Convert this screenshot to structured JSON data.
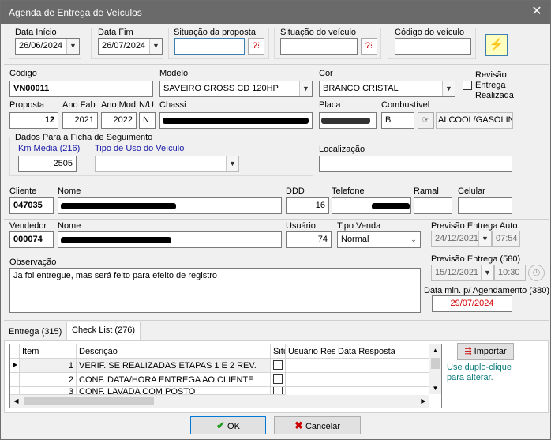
{
  "window": {
    "title": "Agenda de Entrega de Veículos",
    "close": "✕"
  },
  "filters": {
    "data_inicio_label": "Data Início",
    "data_inicio_value": "26/06/2024",
    "data_fim_label": "Data Fim",
    "data_fim_value": "26/07/2024",
    "situacao_proposta_label": "Situação da proposta",
    "situacao_veiculo_label": "Situação do veículo",
    "codigo_veiculo_label": "Código do veículo"
  },
  "vehicle": {
    "codigo_label": "Código",
    "codigo_value": "VN00011",
    "modelo_label": "Modelo",
    "modelo_value": "SAVEIRO CROSS CD 120HP",
    "cor_label": "Cor",
    "cor_value": "BRANCO CRISTAL",
    "revisao_label_1": "Revisão",
    "revisao_label_2": "Entrega",
    "revisao_label_3": "Realizada",
    "proposta_label": "Proposta",
    "proposta_value": "12",
    "ano_fab_label": "Ano Fab",
    "ano_fab_value": "2021",
    "ano_mod_label": "Ano Mod",
    "ano_mod_value": "2022",
    "nu_label": "N/U",
    "nu_value": "N",
    "chassi_label": "Chassi",
    "placa_label": "Placa",
    "combustivel_label": "Combustível",
    "combustivel_code": "B",
    "combustivel_desc": "ALCOOL/GASOLINA",
    "ficha_label": "Dados Para a Ficha de Seguimento",
    "km_label": "Km Média (216)",
    "km_value": "2505",
    "tipo_uso_label": "Tipo de Uso do Veículo",
    "localizacao_label": "Localização"
  },
  "cliente": {
    "cliente_label": "Cliente",
    "cliente_value": "047035",
    "nome_label": "Nome",
    "ddd_label": "DDD",
    "ddd_value": "16",
    "telefone_label": "Telefone",
    "ramal_label": "Ramal",
    "celular_label": "Celular"
  },
  "vendedor": {
    "vendedor_label": "Vendedor",
    "vendedor_value": "000074",
    "nome_label": "Nome",
    "usuario_label": "Usuário",
    "usuario_value": "74",
    "tipo_venda_label": "Tipo Venda",
    "tipo_venda_value": "Normal",
    "prev_auto_label": "Previsão Entrega Auto.",
    "prev_auto_date": "24/12/2021",
    "prev_auto_time": "07:54",
    "obs_label": "Observação",
    "obs_value": "Ja foi entregue, mas será feito para efeito de registro",
    "prev_580_label": "Previsão Entrega (580)",
    "prev_580_date": "15/12/2021",
    "prev_580_time": "10:30",
    "data_min_label": "Data min. p/ Agendamento (380)",
    "data_min_value": "29/07/2024"
  },
  "tabs": [
    {
      "label": "Entrega (315)"
    },
    {
      "label": "Check List (276)"
    }
  ],
  "grid": {
    "headers": [
      "Item",
      "Descrição",
      "Situ",
      "Usuário Resp",
      "Data Resposta"
    ],
    "rows": [
      {
        "item": "1",
        "desc": "VERIF. SE REALIZADAS ETAPAS 1 E 2 REV."
      },
      {
        "item": "2",
        "desc": "CONF. DATA/HORA ENTREGA AO CLIENTE"
      },
      {
        "item": "3",
        "desc": "CONF. LAVADA COM POSTO"
      }
    ]
  },
  "importar": {
    "label": "Importar",
    "hint_1": "Use duplo-clique",
    "hint_2": "para alterar."
  },
  "footer": {
    "ok_label": "OK",
    "cancel_label": "Cancelar"
  },
  "colors": {
    "title_bg": "#6a6a6a",
    "label_blue": "#1a1aa6",
    "date_red": "#d40000",
    "hint_teal": "#0a7a7a"
  }
}
